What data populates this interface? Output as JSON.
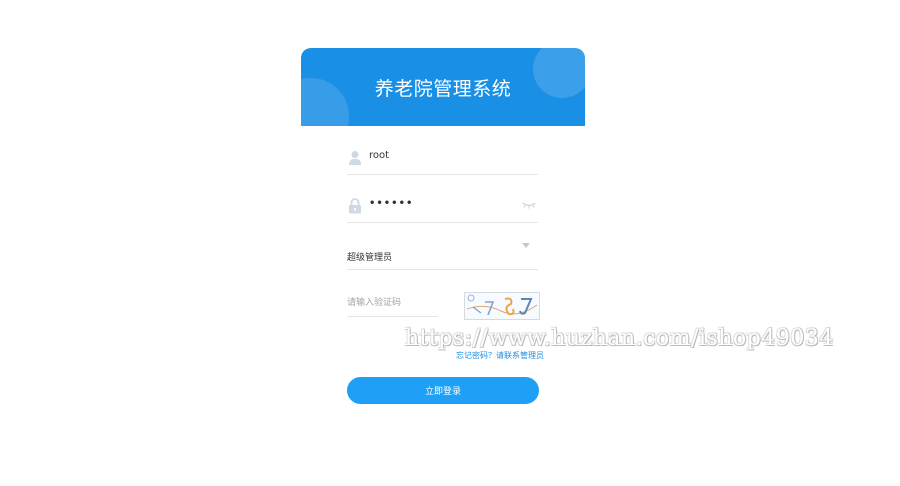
{
  "header": {
    "title": "养老院管理系统"
  },
  "form": {
    "username": {
      "value": "root",
      "icon": "user-icon"
    },
    "password": {
      "value": "••••••",
      "icon": "lock-icon",
      "toggle_icon": "eye-closed-icon"
    },
    "role": {
      "selected": "超级管理员"
    },
    "captcha": {
      "placeholder": "请输入验证码"
    },
    "forgot_text": "忘记密码？请联系管理员",
    "login_label": "立即登录"
  },
  "watermark": "https://www.huzhan.com/ishop49034",
  "colors": {
    "primary": "#1a8fe6",
    "button": "#1da0f5"
  }
}
